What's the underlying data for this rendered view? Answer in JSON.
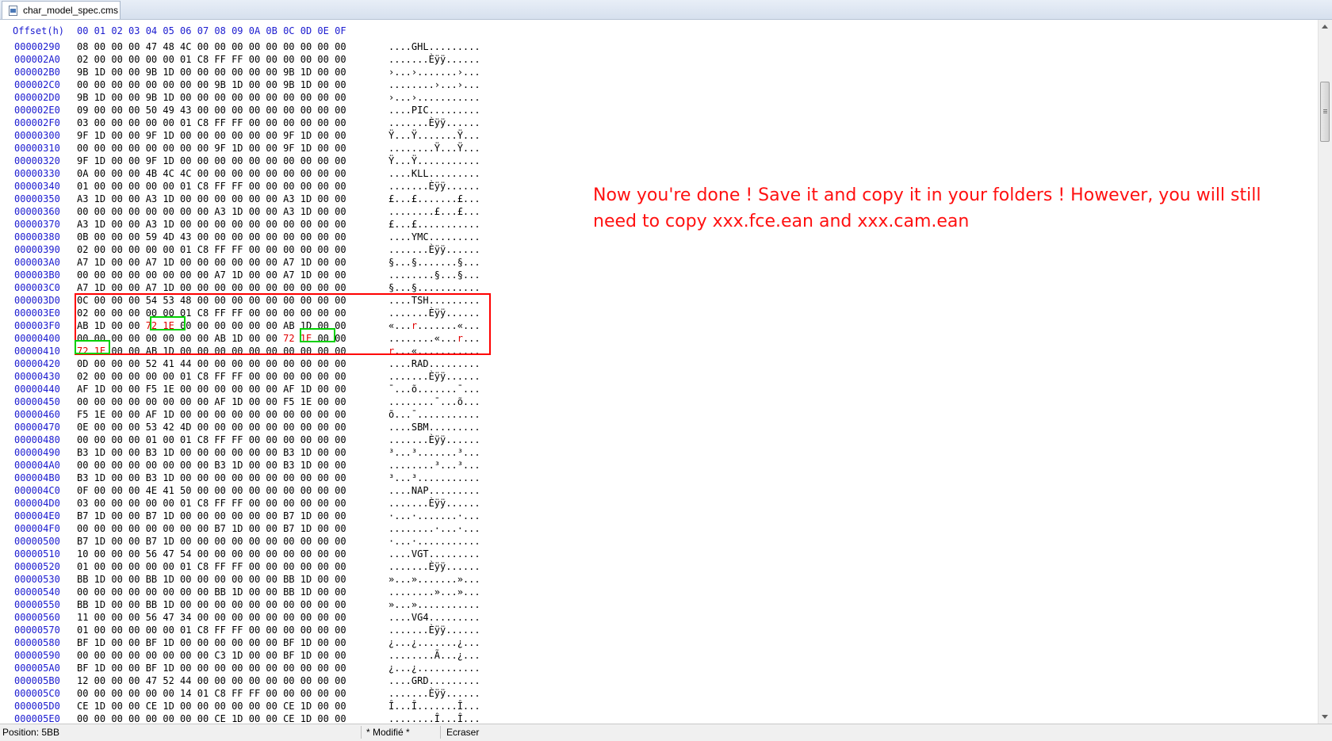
{
  "tab": {
    "title": "char_model_spec.cms"
  },
  "header": {
    "offset_label": "Offset(h)",
    "columns": "00 01 02 03 04 05 06 07 08 09 0A 0B 0C 0D 0E 0F"
  },
  "rows": [
    {
      "offset": "00000290",
      "hex": "08 00 00 00 47 48 4C 00 00 00 00 00 00 00 00 00",
      "ascii": "....GHL........."
    },
    {
      "offset": "000002A0",
      "hex": "02 00 00 00 00 00 01 C8 FF FF 00 00 00 00 00 00",
      "ascii": ".......Èÿÿ......"
    },
    {
      "offset": "000002B0",
      "hex": "9B 1D 00 00 9B 1D 00 00 00 00 00 00 9B 1D 00 00",
      "ascii": "›...›.......›..."
    },
    {
      "offset": "000002C0",
      "hex": "00 00 00 00 00 00 00 00 9B 1D 00 00 9B 1D 00 00",
      "ascii": "........›...›..."
    },
    {
      "offset": "000002D0",
      "hex": "9B 1D 00 00 9B 1D 00 00 00 00 00 00 00 00 00 00",
      "ascii": "›...›..........."
    },
    {
      "offset": "000002E0",
      "hex": "09 00 00 00 50 49 43 00 00 00 00 00 00 00 00 00",
      "ascii": "....PIC........."
    },
    {
      "offset": "000002F0",
      "hex": "03 00 00 00 00 00 01 C8 FF FF 00 00 00 00 00 00",
      "ascii": ".......Èÿÿ......"
    },
    {
      "offset": "00000300",
      "hex": "9F 1D 00 00 9F 1D 00 00 00 00 00 00 9F 1D 00 00",
      "ascii": "Ÿ...Ÿ.......Ÿ..."
    },
    {
      "offset": "00000310",
      "hex": "00 00 00 00 00 00 00 00 9F 1D 00 00 9F 1D 00 00",
      "ascii": "........Ÿ...Ÿ..."
    },
    {
      "offset": "00000320",
      "hex": "9F 1D 00 00 9F 1D 00 00 00 00 00 00 00 00 00 00",
      "ascii": "Ÿ...Ÿ..........."
    },
    {
      "offset": "00000330",
      "hex": "0A 00 00 00 4B 4C 4C 00 00 00 00 00 00 00 00 00",
      "ascii": "....KLL........."
    },
    {
      "offset": "00000340",
      "hex": "01 00 00 00 00 00 01 C8 FF FF 00 00 00 00 00 00",
      "ascii": ".......Èÿÿ......"
    },
    {
      "offset": "00000350",
      "hex": "A3 1D 00 00 A3 1D 00 00 00 00 00 00 A3 1D 00 00",
      "ascii": "£...£.......£..."
    },
    {
      "offset": "00000360",
      "hex": "00 00 00 00 00 00 00 00 A3 1D 00 00 A3 1D 00 00",
      "ascii": "........£...£..."
    },
    {
      "offset": "00000370",
      "hex": "A3 1D 00 00 A3 1D 00 00 00 00 00 00 00 00 00 00",
      "ascii": "£...£..........."
    },
    {
      "offset": "00000380",
      "hex": "0B 00 00 00 59 4D 43 00 00 00 00 00 00 00 00 00",
      "ascii": "....YMC........."
    },
    {
      "offset": "00000390",
      "hex": "02 00 00 00 00 00 01 C8 FF FF 00 00 00 00 00 00",
      "ascii": ".......Èÿÿ......"
    },
    {
      "offset": "000003A0",
      "hex": "A7 1D 00 00 A7 1D 00 00 00 00 00 00 A7 1D 00 00",
      "ascii": "§...§.......§..."
    },
    {
      "offset": "000003B0",
      "hex": "00 00 00 00 00 00 00 00 A7 1D 00 00 A7 1D 00 00",
      "ascii": "........§...§..."
    },
    {
      "offset": "000003C0",
      "hex": "A7 1D 00 00 A7 1D 00 00 00 00 00 00 00 00 00 00",
      "ascii": "§...§..........."
    },
    {
      "offset": "000003D0",
      "hex": "0C 00 00 00 54 53 48 00 00 00 00 00 00 00 00 00",
      "ascii": "....TSH........."
    },
    {
      "offset": "000003E0",
      "hex": "02 00 00 00 00 00 01 C8 FF FF 00 00 00 00 00 00",
      "ascii": ".......Èÿÿ......"
    },
    {
      "offset": "000003F0",
      "hex": "AB 1D 00 00 72 1E 00 00 00 00 00 00 AB 1D 00 00",
      "ascii": "«...r.......«..."
    },
    {
      "offset": "00000400",
      "hex": "00 00 00 00 00 00 00 00 AB 1D 00 00 72 1E 00 00",
      "ascii": "........«...r..."
    },
    {
      "offset": "00000410",
      "hex": "72 1E 00 00 AB 1D 00 00 00 00 00 00 00 00 00 00",
      "ascii": "r...«..........."
    },
    {
      "offset": "00000420",
      "hex": "0D 00 00 00 52 41 44 00 00 00 00 00 00 00 00 00",
      "ascii": "....RAD........."
    },
    {
      "offset": "00000430",
      "hex": "02 00 00 00 00 00 01 C8 FF FF 00 00 00 00 00 00",
      "ascii": ".......Èÿÿ......"
    },
    {
      "offset": "00000440",
      "hex": "AF 1D 00 00 F5 1E 00 00 00 00 00 00 AF 1D 00 00",
      "ascii": "¯...õ.......¯..."
    },
    {
      "offset": "00000450",
      "hex": "00 00 00 00 00 00 00 00 AF 1D 00 00 F5 1E 00 00",
      "ascii": "........¯...õ..."
    },
    {
      "offset": "00000460",
      "hex": "F5 1E 00 00 AF 1D 00 00 00 00 00 00 00 00 00 00",
      "ascii": "õ...¯..........."
    },
    {
      "offset": "00000470",
      "hex": "0E 00 00 00 53 42 4D 00 00 00 00 00 00 00 00 00",
      "ascii": "....SBM........."
    },
    {
      "offset": "00000480",
      "hex": "00 00 00 00 01 00 01 C8 FF FF 00 00 00 00 00 00",
      "ascii": ".......Èÿÿ......"
    },
    {
      "offset": "00000490",
      "hex": "B3 1D 00 00 B3 1D 00 00 00 00 00 00 B3 1D 00 00",
      "ascii": "³...³.......³..."
    },
    {
      "offset": "000004A0",
      "hex": "00 00 00 00 00 00 00 00 B3 1D 00 00 B3 1D 00 00",
      "ascii": "........³...³..."
    },
    {
      "offset": "000004B0",
      "hex": "B3 1D 00 00 B3 1D 00 00 00 00 00 00 00 00 00 00",
      "ascii": "³...³..........."
    },
    {
      "offset": "000004C0",
      "hex": "0F 00 00 00 4E 41 50 00 00 00 00 00 00 00 00 00",
      "ascii": "....NAP........."
    },
    {
      "offset": "000004D0",
      "hex": "03 00 00 00 00 00 01 C8 FF FF 00 00 00 00 00 00",
      "ascii": ".......Èÿÿ......"
    },
    {
      "offset": "000004E0",
      "hex": "B7 1D 00 00 B7 1D 00 00 00 00 00 00 B7 1D 00 00",
      "ascii": "·...·.......·..."
    },
    {
      "offset": "000004F0",
      "hex": "00 00 00 00 00 00 00 00 B7 1D 00 00 B7 1D 00 00",
      "ascii": "........·...·..."
    },
    {
      "offset": "00000500",
      "hex": "B7 1D 00 00 B7 1D 00 00 00 00 00 00 00 00 00 00",
      "ascii": "·...·..........."
    },
    {
      "offset": "00000510",
      "hex": "10 00 00 00 56 47 54 00 00 00 00 00 00 00 00 00",
      "ascii": "....VGT........."
    },
    {
      "offset": "00000520",
      "hex": "01 00 00 00 00 00 01 C8 FF FF 00 00 00 00 00 00",
      "ascii": ".......Èÿÿ......"
    },
    {
      "offset": "00000530",
      "hex": "BB 1D 00 00 BB 1D 00 00 00 00 00 00 BB 1D 00 00",
      "ascii": "»...».......»..."
    },
    {
      "offset": "00000540",
      "hex": "00 00 00 00 00 00 00 00 BB 1D 00 00 BB 1D 00 00",
      "ascii": "........»...»..."
    },
    {
      "offset": "00000550",
      "hex": "BB 1D 00 00 BB 1D 00 00 00 00 00 00 00 00 00 00",
      "ascii": "»...»..........."
    },
    {
      "offset": "00000560",
      "hex": "11 00 00 00 56 47 34 00 00 00 00 00 00 00 00 00",
      "ascii": "....VG4........."
    },
    {
      "offset": "00000570",
      "hex": "01 00 00 00 00 00 01 C8 FF FF 00 00 00 00 00 00",
      "ascii": ".......Èÿÿ......"
    },
    {
      "offset": "00000580",
      "hex": "BF 1D 00 00 BF 1D 00 00 00 00 00 00 BF 1D 00 00",
      "ascii": "¿...¿.......¿..."
    },
    {
      "offset": "00000590",
      "hex": "00 00 00 00 00 00 00 00 C3 1D 00 00 BF 1D 00 00",
      "ascii": "........Ã...¿..."
    },
    {
      "offset": "000005A0",
      "hex": "BF 1D 00 00 BF 1D 00 00 00 00 00 00 00 00 00 00",
      "ascii": "¿...¿..........."
    },
    {
      "offset": "000005B0",
      "hex": "12 00 00 00 47 52 44 00 00 00 00 00 00 00 00 00",
      "ascii": "....GRD........."
    },
    {
      "offset": "000005C0",
      "hex": "00 00 00 00 00 00 14 01 C8 FF FF 00 00 00 00 00",
      "ascii": ".......Èÿÿ......"
    },
    {
      "offset": "000005D0",
      "hex": "CE 1D 00 00 CE 1D 00 00 00 00 00 00 CE 1D 00 00",
      "ascii": "Î...Î.......Î..."
    },
    {
      "offset": "000005E0",
      "hex": "00 00 00 00 00 00 00 00 CE 1D 00 00 CE 1D 00 00",
      "ascii": "........Î...Î..."
    }
  ],
  "annotation": {
    "text": "Now you're done ! Save it and copy it in your folders ! However, you will still need to copy xxx.fce.ean and xxx.cam.ean"
  },
  "status": {
    "position": "Position: 5BB",
    "modified": "* Modifié *",
    "mode": "Ecraser"
  },
  "colors": {
    "offset": "#1b1bd0",
    "highlight": "#e00000",
    "box_red": "#ff0000",
    "box_green": "#00d000"
  }
}
